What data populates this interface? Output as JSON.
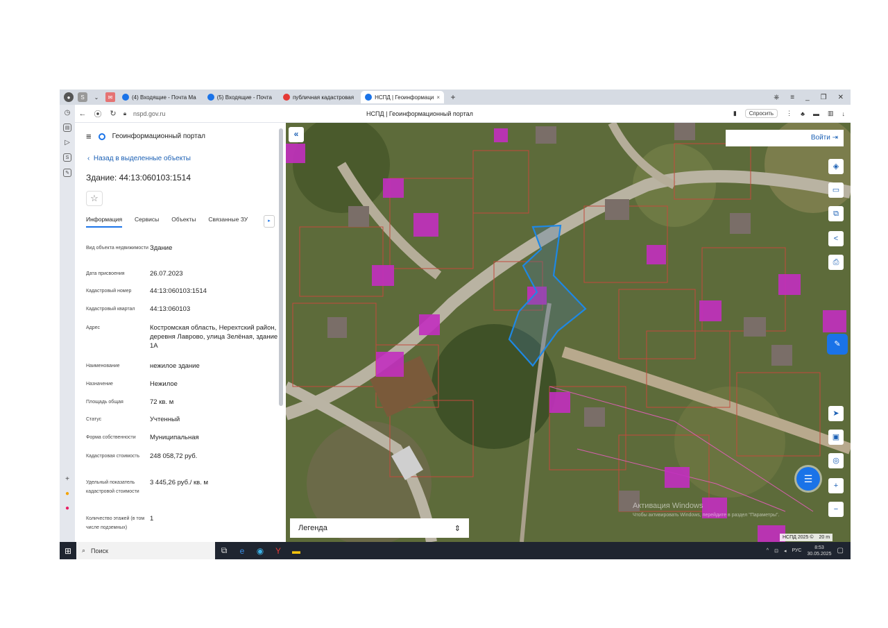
{
  "browser": {
    "tabs": [
      {
        "label": "(4) Входящие - Почта Ма",
        "color": "#1a73e8"
      },
      {
        "label": "(5) Входящие - Почта",
        "color": "#1a73e8"
      },
      {
        "label": "публичная кадастровая",
        "color": "#e53935"
      },
      {
        "label": "НСПД | Геоинформаци",
        "color": "#1a73e8",
        "active": true
      }
    ],
    "url": "nspd.gov.ru",
    "page_title": "НСПД | Геоинформационный портал",
    "ask_label": "Спросить"
  },
  "panel": {
    "portal_name": "Геоинформационный портал",
    "back_link": "Назад в выделенные объекты",
    "object_title": "Здание: 44:13:060103:1514",
    "tabs": [
      "Информация",
      "Сервисы",
      "Объекты",
      "Связанные ЗУ"
    ],
    "properties": [
      {
        "key": "Вид объекта недвижимости",
        "value": "Здание"
      },
      {
        "key": "Дата присвоения",
        "value": "26.07.2023"
      },
      {
        "key": "Кадастровый номер",
        "value": "44:13:060103:1514"
      },
      {
        "key": "Кадастровый квартал",
        "value": "44:13:060103"
      },
      {
        "key": "Адрес",
        "value": "Костромская область, Нерехтский район, деревня Лаврово, улица Зелёная, здание 1А"
      },
      {
        "key": "Наименование",
        "value": "нежилое здание"
      },
      {
        "key": "Назначение",
        "value": "Нежилое"
      },
      {
        "key": "Площадь общая",
        "value": "72 кв. м"
      },
      {
        "key": "Статус",
        "value": "Учтенный"
      },
      {
        "key": "Форма собственности",
        "value": "Муниципальная"
      },
      {
        "key": "Кадастровая стоимость",
        "value": "248 058,72 руб."
      },
      {
        "key": "Удельный показатель кадастровой стоимости",
        "value": "3 445,26 руб./ кв. м"
      },
      {
        "key": "Количество этажей (в том числе подземных)",
        "value": "1"
      }
    ]
  },
  "map": {
    "login_label": "Войти",
    "legend_label": "Легенда",
    "activation_title": "Активация Windows",
    "activation_sub": "Чтобы активировать Windows, перейдите в раздел \"Параметры\".",
    "scale_left": "НСПД 2025 ©",
    "scale_right": "20 m"
  },
  "taskbar": {
    "search_placeholder": "Поиск",
    "lang": "РУС",
    "time": "8:53",
    "date": "30.05.2025"
  }
}
